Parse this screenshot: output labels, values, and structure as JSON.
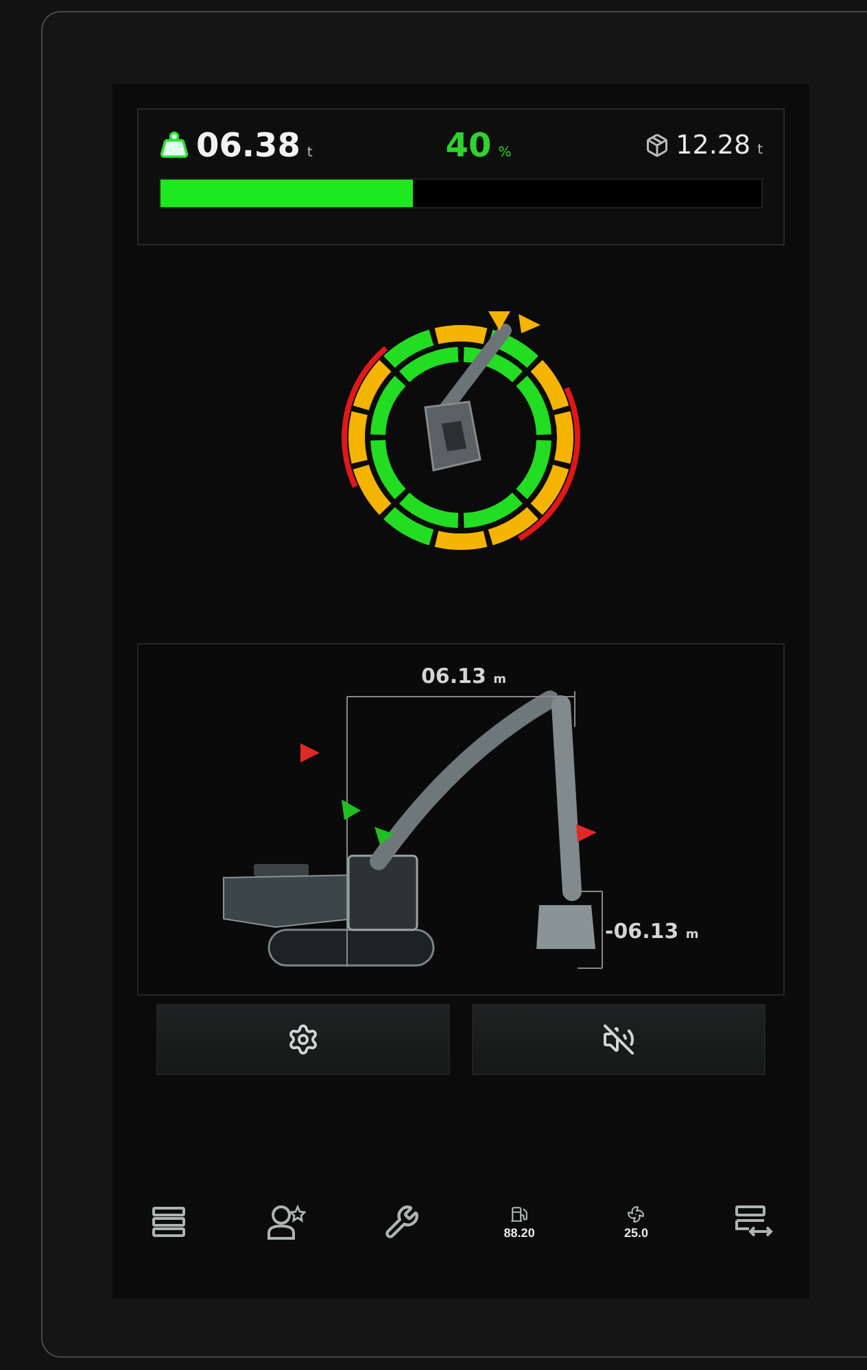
{
  "load": {
    "current": {
      "value": "06.38",
      "unit": "t"
    },
    "percent": {
      "value": "40",
      "unit": "%"
    },
    "capacity": {
      "value": "12.28",
      "unit": "t"
    },
    "level": 0.42
  },
  "reach": {
    "horizontal": {
      "value": "06.13",
      "unit": "m"
    },
    "depth": {
      "value": "-06.13",
      "unit": "m"
    }
  },
  "action_buttons": [
    {
      "kind": "settings"
    },
    {
      "kind": "mute"
    }
  ],
  "nav": [
    {
      "kind": "menu"
    },
    {
      "kind": "operator"
    },
    {
      "kind": "service"
    },
    {
      "kind": "fuel",
      "reading": "88.20"
    },
    {
      "kind": "fan",
      "reading": "25.0"
    },
    {
      "kind": "switch"
    }
  ]
}
